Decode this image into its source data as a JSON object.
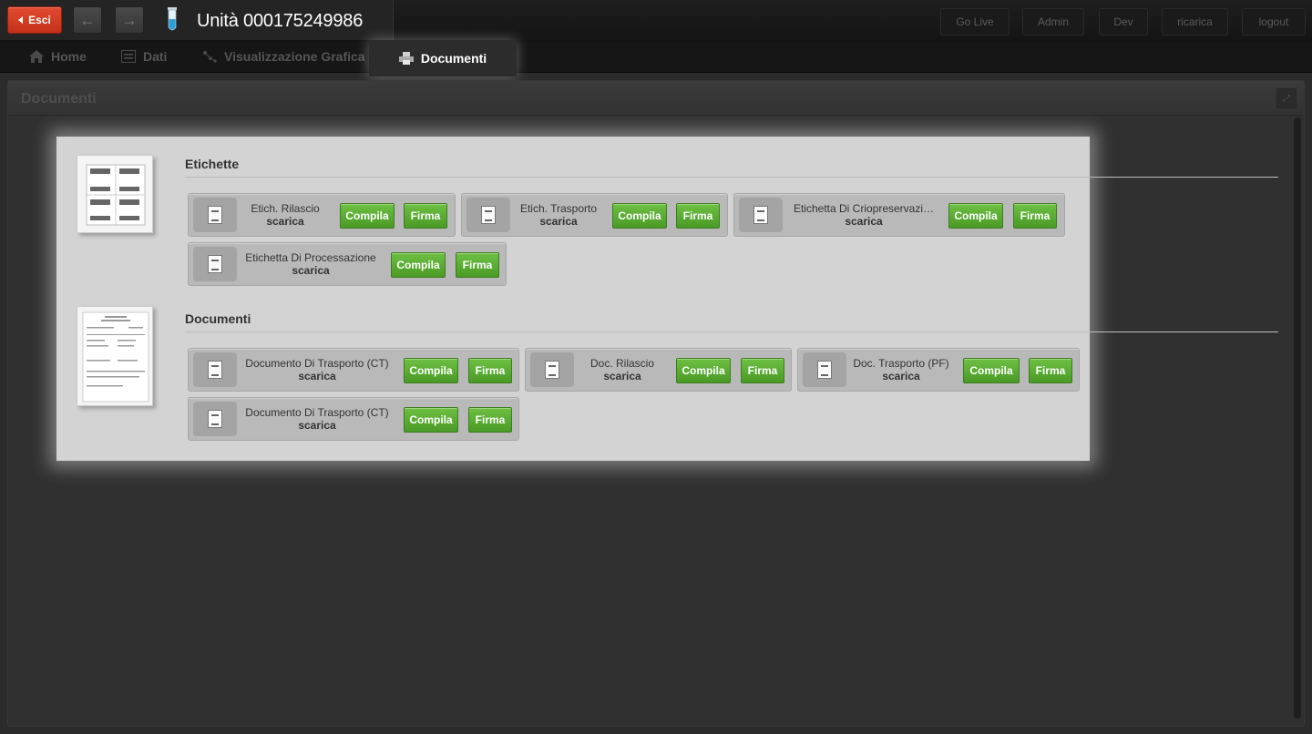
{
  "header": {
    "exit_label": "Esci",
    "back_icon": "arrow-left-icon",
    "forward_icon": "arrow-right-icon",
    "unit_title": "Unità 000175249986",
    "buttons": [
      "Go Live",
      "Admin",
      "Dev",
      "ricarica",
      "logout"
    ]
  },
  "tabs": [
    {
      "label": "Home",
      "icon": "home-icon"
    },
    {
      "label": "Dati",
      "icon": "list-icon"
    },
    {
      "label": "Visualizzazione Grafica",
      "icon": "graph-icon"
    },
    {
      "label": "Documenti",
      "icon": "printer-icon"
    }
  ],
  "panel": {
    "title": "Documenti"
  },
  "sections": [
    {
      "title": "Etichette",
      "items": [
        {
          "name": "Etich. Rilascio",
          "sub": "scarica",
          "compila": "Compila",
          "firma": "Firma"
        },
        {
          "name": "Etich. Trasporto",
          "sub": "scarica",
          "compila": "Compila",
          "firma": "Firma"
        },
        {
          "name": "Etichetta Di Criopreservazi…",
          "sub": "scarica",
          "compila": "Compila",
          "firma": "Firma"
        },
        {
          "name": "Etichetta Di Processazione",
          "sub": "scarica",
          "compila": "Compila",
          "firma": "Firma"
        }
      ]
    },
    {
      "title": "Documenti",
      "items": [
        {
          "name": "Documento Di Trasporto (CT)",
          "sub": "scarica",
          "compila": "Compila",
          "firma": "Firma"
        },
        {
          "name": "Doc. Rilascio",
          "sub": "scarica",
          "compila": "Compila",
          "firma": "Firma"
        },
        {
          "name": "Doc. Trasporto (PF)",
          "sub": "scarica",
          "compila": "Compila",
          "firma": "Firma"
        },
        {
          "name": "Documento Di Trasporto (CT)",
          "sub": "scarica",
          "compila": "Compila",
          "firma": "Firma"
        }
      ]
    }
  ],
  "colors": {
    "accent_red": "#d23a20",
    "accent_green": "#5cad33",
    "background": "#2b2b2b"
  }
}
